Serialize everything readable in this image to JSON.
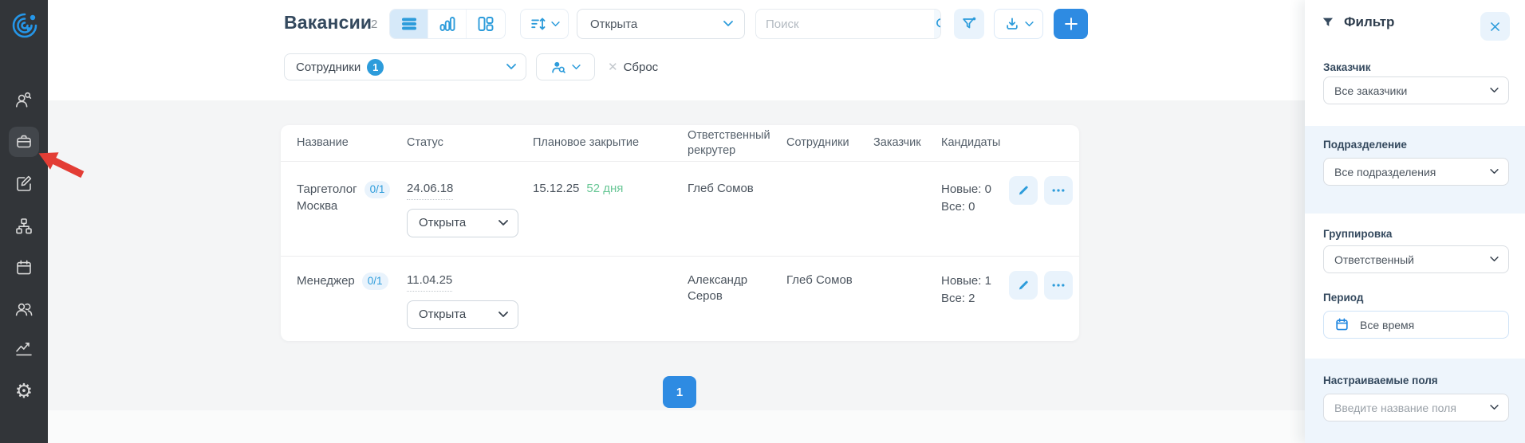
{
  "colors": {
    "accent_blue": "#2d9cdb",
    "solid_blue": "#2e8be2",
    "green_days": "#69c796",
    "sidebar_bg": "#323539",
    "annotation_red": "#e33d35",
    "panel_band": "#eef5fc"
  },
  "sidebar": {
    "items": [
      {
        "name": "logo"
      },
      {
        "name": "candidate-search"
      },
      {
        "name": "vacancies",
        "active": true
      },
      {
        "name": "edit-requests"
      },
      {
        "name": "org-structure"
      },
      {
        "name": "calendar"
      },
      {
        "name": "employees"
      },
      {
        "name": "analytics"
      },
      {
        "name": "settings"
      }
    ]
  },
  "header": {
    "title": "Вакансии",
    "count": "2",
    "status_filter_value": "Открыта",
    "search_placeholder": "Поиск",
    "employees_filter_label": "Сотрудники",
    "employees_filter_badge": "1",
    "reset_label": "Сброс"
  },
  "table": {
    "columns": [
      "Название",
      "Статус",
      "Плановое закрытие",
      "Ответственный рекрутер",
      "Сотрудники",
      "Заказчик",
      "Кандидаты"
    ],
    "rows": [
      {
        "name": "Таргетолог",
        "location": "Москва",
        "ratio": "0/1",
        "created": "24.06.18",
        "status": "Открыта",
        "planned_close": "15.12.25",
        "days_left": "52 дня",
        "recruiter": "Глеб Сомов",
        "employees": "",
        "customer": "",
        "candidates_new": "Новые: 0",
        "candidates_all": "Все: 0"
      },
      {
        "name": "Менеджер",
        "location": "",
        "ratio": "0/1",
        "created": "11.04.25",
        "status": "Открыта",
        "planned_close": "",
        "days_left": "",
        "recruiter": "Александр Серов",
        "employees": "Глеб Сомов",
        "customer": "",
        "candidates_new": "Новые: 1",
        "candidates_all": "Все: 2"
      }
    ]
  },
  "pagination": {
    "current_page": "1"
  },
  "filter_panel": {
    "title": "Фильтр",
    "customer_label": "Заказчик",
    "customer_value": "Все заказчики",
    "department_label": "Подразделение",
    "department_value": "Все подразделения",
    "grouping_label": "Группировка",
    "grouping_value": "Ответственный",
    "period_label": "Период",
    "period_value": "Все время",
    "custom_fields_label": "Настраиваемые поля",
    "custom_fields_placeholder": "Введите название поля"
  }
}
